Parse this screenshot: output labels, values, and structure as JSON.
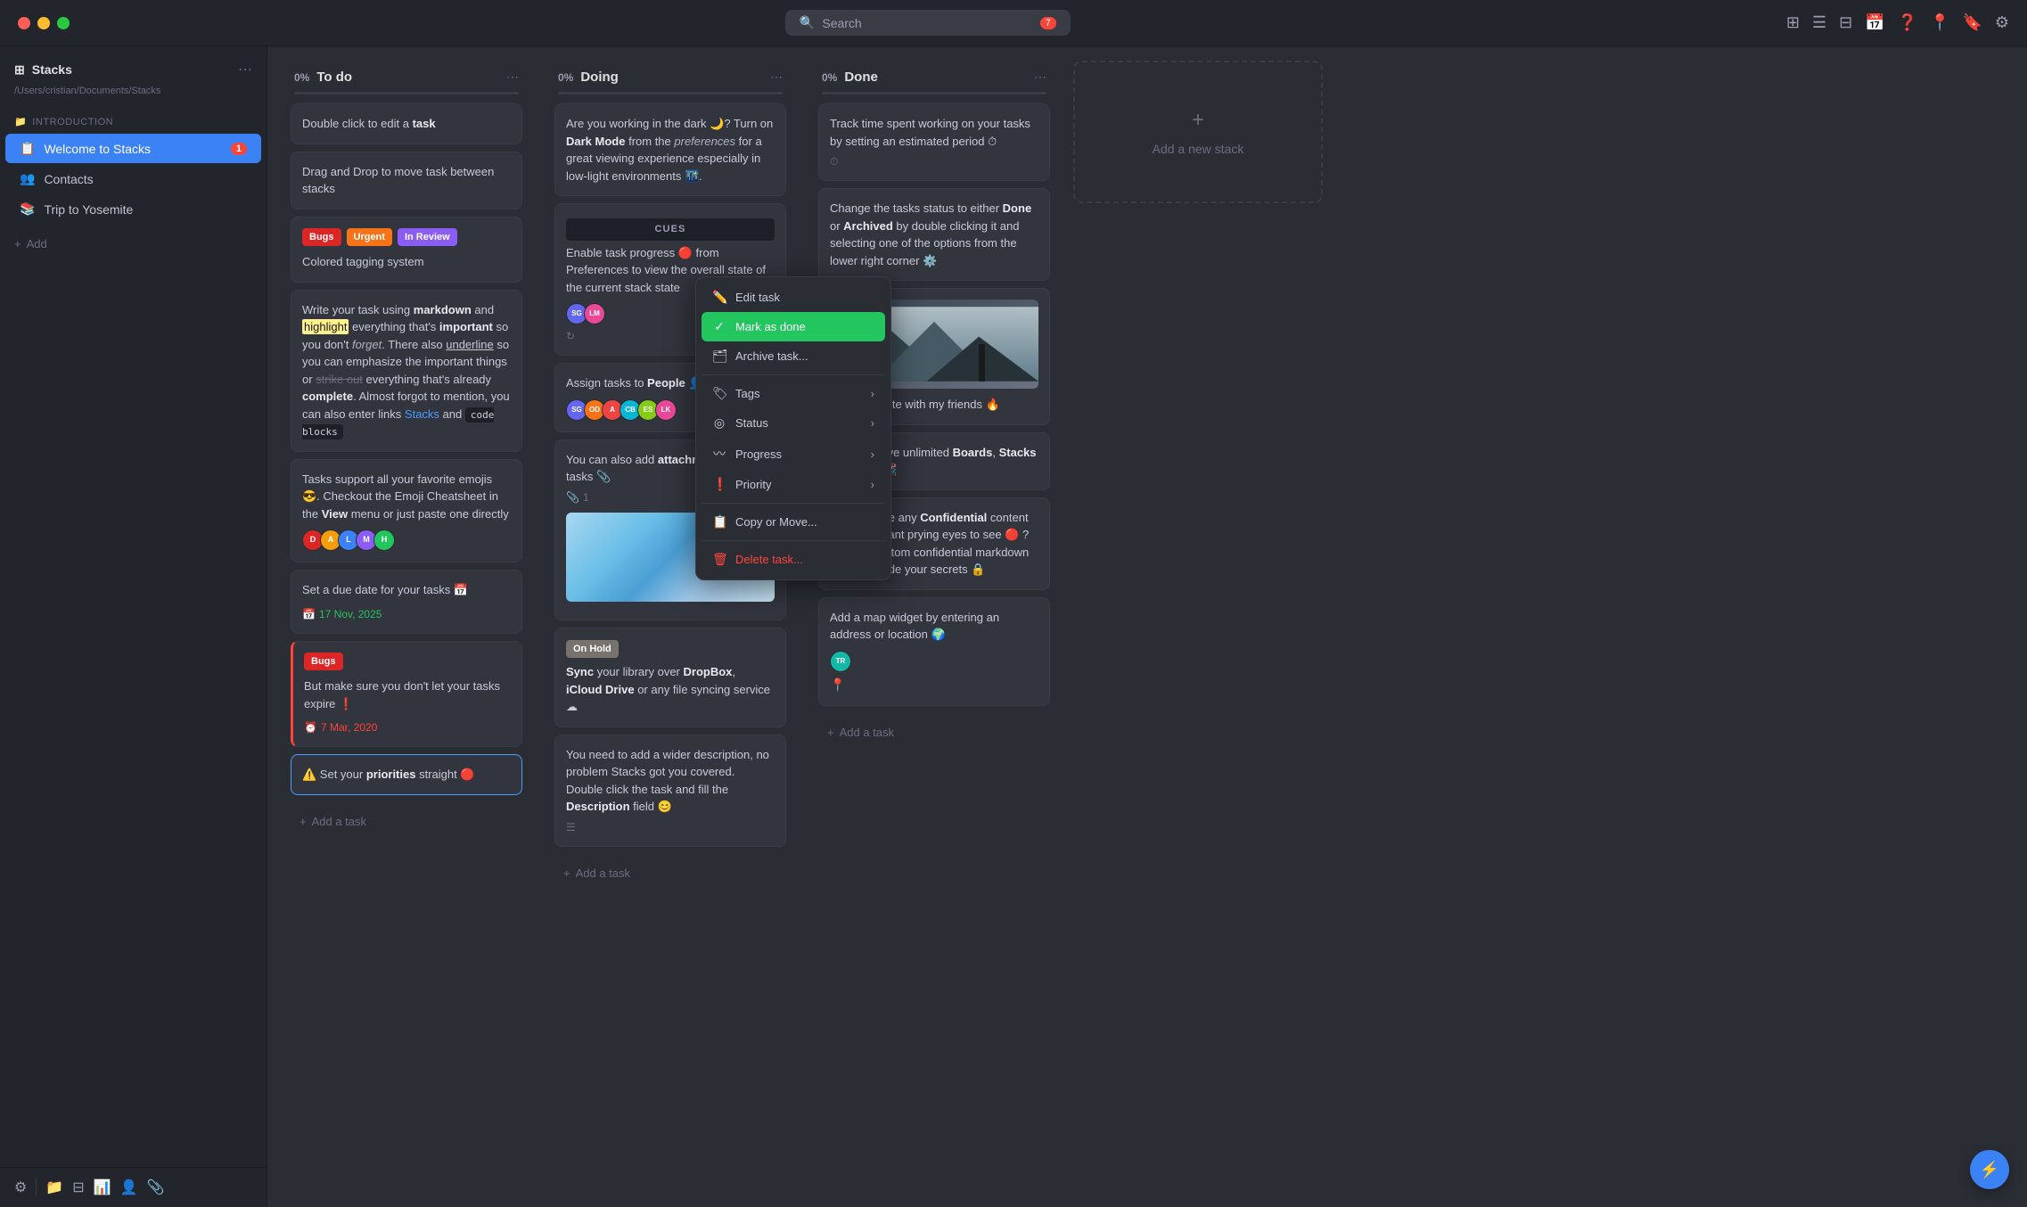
{
  "app": {
    "name": "Stacks",
    "path": "/Users/cristian/Documents/Stacks"
  },
  "topbar": {
    "search_placeholder": "Search",
    "icons": [
      "grid-icon",
      "list-icon",
      "table-icon",
      "calendar-icon",
      "help-icon",
      "location-icon",
      "bookmark-icon",
      "sliders-icon"
    ]
  },
  "sidebar": {
    "section_label": "Introduction",
    "items": [
      {
        "id": "welcome",
        "label": "Welcome to Stacks",
        "badge": "1",
        "active": true,
        "icon": "📋"
      },
      {
        "id": "contacts",
        "label": "Contacts",
        "icon": "👥"
      },
      {
        "id": "trip",
        "label": "Trip to Yosemite",
        "icon": "📚"
      }
    ],
    "add_label": "+ Add"
  },
  "footer": {
    "icons": [
      "settings-icon",
      "folder-icon",
      "table-icon",
      "chart-icon",
      "person-icon",
      "paperclip-icon"
    ]
  },
  "stacks": [
    {
      "id": "todo",
      "progress": "0%",
      "title": "To do",
      "cards": [
        {
          "id": "c1",
          "text": "Double click to edit a task"
        },
        {
          "id": "c2",
          "text": "Drag and Drop to move task between stacks"
        },
        {
          "id": "c3",
          "tags": [
            "Bugs",
            "Urgent",
            "In Review"
          ],
          "text": "Colored tagging system"
        },
        {
          "id": "c4",
          "text": "Write your task using markdown and highlight everything that's important so you don't forget. There also underline so you can emphasize the important things or strike out everything that's already complete. Almost forgot to mention, you can also enter links Stacks and code blocks",
          "has_code": true
        },
        {
          "id": "c5",
          "text": "Tasks support all your favorite emojis 😎. Checkout the Emoji Cheatsheet in the View menu or just paste one directly",
          "avatars": [
            "D",
            "A",
            "L",
            "M",
            "H"
          ]
        },
        {
          "id": "c6",
          "text": "Set a due date for your tasks 📅",
          "date": "17 Nov, 2025",
          "date_ok": true
        },
        {
          "id": "c7",
          "tags": [
            "Bugs"
          ],
          "text": "But make sure you don't let your tasks expire ❗",
          "date": "7 Mar, 2020",
          "date_ok": false,
          "expired": true
        },
        {
          "id": "c8",
          "text": "Set your priorities straight 🔴",
          "priority_style": true
        }
      ],
      "add_label": "+ Add a task"
    },
    {
      "id": "doing",
      "progress": "0%",
      "title": "Doing",
      "cards": [
        {
          "id": "d1",
          "text": "Are you working in the dark 🌙? Turn on Dark Mode from the preferences for a great viewing experience especially in low-light environments 🌃."
        },
        {
          "id": "d2",
          "cues": true,
          "text": "Enable task progress 🔴 from Preferences to view the overall state of the current stack state",
          "avatars_code": [
            "SG",
            "LM"
          ]
        },
        {
          "id": "d3",
          "text": "Assign tasks to People 👤",
          "avatars_2": [
            "SG",
            "OD",
            "A",
            "CB",
            "ES",
            "LK"
          ]
        },
        {
          "id": "d4",
          "text": "You can also add attachments to your tasks 📎",
          "attachment_count": "1",
          "has_image": true
        },
        {
          "id": "d5",
          "on_hold": true,
          "text": "Sync your library over DropBox, iCloud Drive or any file syncing service ☁"
        },
        {
          "id": "d6",
          "text": "You need to add a wider description, no problem Stacks got you covered. Double click the task and fill the Description field 😊"
        }
      ],
      "add_label": "+ Add a task"
    },
    {
      "id": "done",
      "progress": "0%",
      "title": "Done",
      "cards": [
        {
          "id": "dn1",
          "text": "Track time spent working on your tasks by setting an estimated period ⏱",
          "has_clock": true
        },
        {
          "id": "dn2",
          "text": "Change the tasks status to either Done or Archived by double clicking it and selecting one of the options from the lower right corner ⚙️"
        },
        {
          "id": "dn3",
          "has_done_image": true,
          "text": "Visit Yosemite with my friends 🔥"
        },
        {
          "id": "dn4",
          "text": "You can have unlimited Boards, Stacks and tasks 🎉"
        },
        {
          "id": "dn5",
          "text": "Do you have any Confidential content you don't want prying eyes to see 🔴 ? Use the custom confidential markdown syntax to hide your secrets 🔒"
        },
        {
          "id": "dn6",
          "text": "Add a map widget by entering an address or location 🌍",
          "avatars_tr": [
            "TR"
          ],
          "has_location": true
        }
      ],
      "add_label": "+ Add a task"
    }
  ],
  "new_stack": {
    "label": "Add a new stack",
    "icon": "+"
  },
  "context_menu": {
    "items": [
      {
        "id": "edit",
        "label": "Edit task",
        "icon": "✏️"
      },
      {
        "id": "mark_done",
        "label": "Mark as done",
        "icon": "✅",
        "active": true
      },
      {
        "id": "archive",
        "label": "Archive task...",
        "icon": "🗂"
      },
      {
        "id": "tags",
        "label": "Tags",
        "icon": "🏷",
        "has_arrow": true
      },
      {
        "id": "status",
        "label": "Status",
        "icon": "◎",
        "has_arrow": true
      },
      {
        "id": "progress",
        "label": "Progress",
        "icon": "〰",
        "has_arrow": true
      },
      {
        "id": "priority",
        "label": "Priority",
        "icon": "❗",
        "has_arrow": true
      },
      {
        "id": "copy",
        "label": "Copy or Move...",
        "icon": "📋"
      },
      {
        "id": "delete",
        "label": "Delete task...",
        "icon": "🗑",
        "danger": true
      }
    ]
  }
}
